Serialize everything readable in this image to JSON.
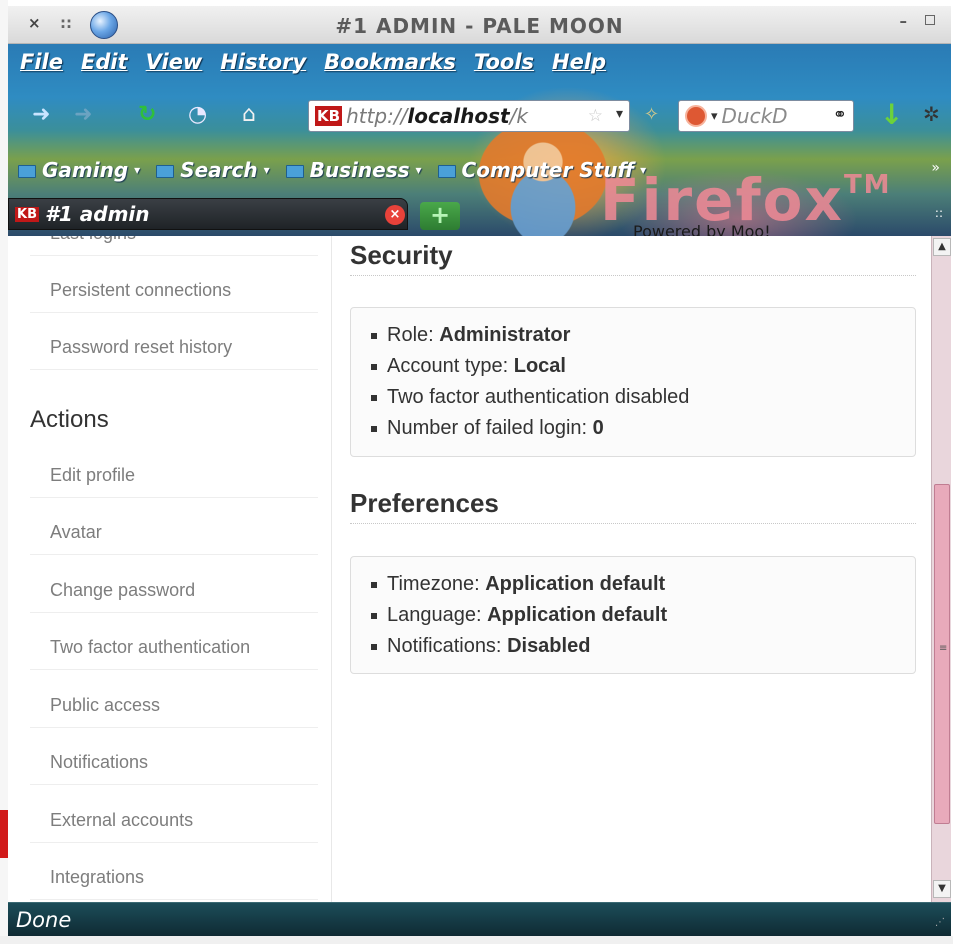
{
  "window": {
    "title": "#1 ADMIN - PALE MOON"
  },
  "menubar": [
    "File",
    "Edit",
    "View",
    "History",
    "Bookmarks",
    "Tools",
    "Help"
  ],
  "navbar": {
    "url_site_badge": "KB",
    "url_prefix": "http://",
    "url_host": "localhost",
    "url_rest": "/k",
    "search_text": "DuckD"
  },
  "bookmarks": [
    "Gaming",
    "Search",
    "Business",
    "Computer Stuff"
  ],
  "persona": {
    "brand": "Firefox",
    "tm": "TM",
    "powered": "Powered by Moo!"
  },
  "tab": {
    "site_badge": "KB",
    "label": "#1 admin"
  },
  "sidebar": {
    "items_top": [
      "Last logins",
      "Persistent connections",
      "Password reset history"
    ],
    "actions_heading": "Actions",
    "actions": [
      "Edit profile",
      "Avatar",
      "Change password",
      "Two factor authentication",
      "Public access",
      "Notifications",
      "External accounts",
      "Integrations"
    ]
  },
  "security": {
    "title": "Security",
    "role_label": "Role: ",
    "role_value": "Administrator",
    "account_label": "Account type: ",
    "account_value": "Local",
    "two_factor": "Two factor authentication disabled",
    "failed_label": "Number of failed login: ",
    "failed_value": "0"
  },
  "preferences": {
    "title": "Preferences",
    "timezone_label": "Timezone: ",
    "timezone_value": "Application default",
    "language_label": "Language: ",
    "language_value": "Application default",
    "notifications_label": "Notifications: ",
    "notifications_value": "Disabled"
  },
  "status": {
    "text": "Done"
  }
}
